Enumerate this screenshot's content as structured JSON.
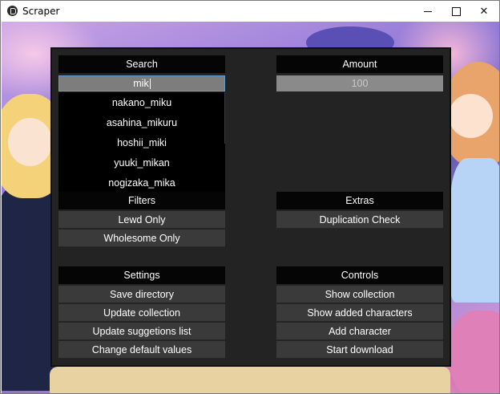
{
  "window": {
    "title": "Scraper",
    "controls": {
      "minimize": "minimize",
      "maximize": "maximize",
      "close": "✕"
    }
  },
  "search": {
    "header": "Search",
    "value": "mik",
    "suggestions": [
      "nakano_miku",
      "asahina_mikuru",
      "hoshii_miki",
      "yuuki_mikan",
      "nogizaka_mika"
    ]
  },
  "amount": {
    "header": "Amount",
    "value": "100"
  },
  "filters": {
    "header": "Filters",
    "buttons": [
      "Lewd Only",
      "Wholesome Only"
    ]
  },
  "extras": {
    "header": "Extras",
    "buttons": [
      "Duplication Check"
    ]
  },
  "settings": {
    "header": "Settings",
    "buttons": [
      "Save directory",
      "Update collection",
      "Update suggetions list",
      "Change default values"
    ]
  },
  "controls": {
    "header": "Controls",
    "buttons": [
      "Show collection",
      "Show added characters",
      "Add character",
      "Start download"
    ]
  },
  "colors": {
    "panel_bg": "#232323",
    "header_bg": "#050505",
    "button_bg": "#3a3a3a",
    "input_focus_border": "#5f9ad1"
  }
}
